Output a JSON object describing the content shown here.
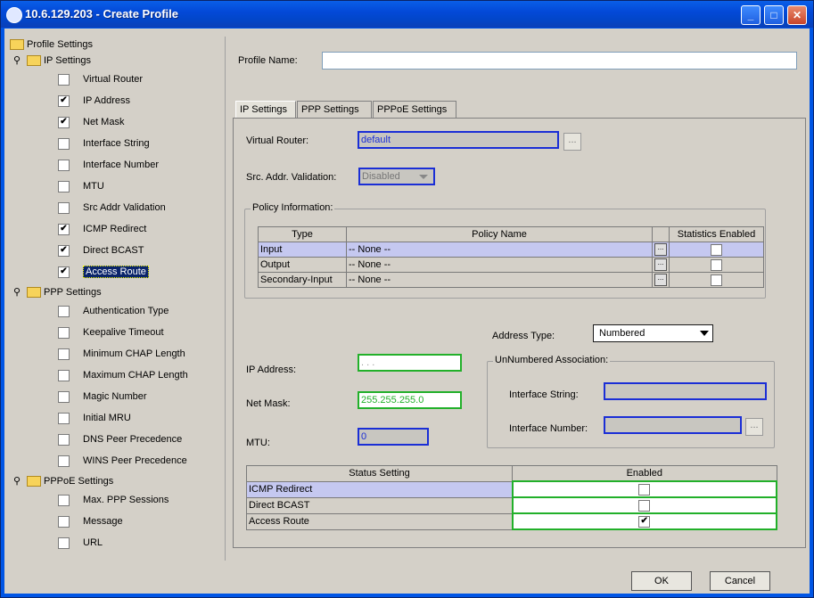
{
  "window": {
    "title": "10.6.129.203 - Create Profile"
  },
  "tree": {
    "root": "Profile Settings",
    "groups": [
      {
        "label": "IP Settings",
        "items": [
          {
            "label": "Virtual Router",
            "checked": false
          },
          {
            "label": "IP Address",
            "checked": true
          },
          {
            "label": "Net Mask",
            "checked": true
          },
          {
            "label": "Interface String",
            "checked": false
          },
          {
            "label": "Interface Number",
            "checked": false
          },
          {
            "label": "MTU",
            "checked": false
          },
          {
            "label": "Src Addr Validation",
            "checked": false
          },
          {
            "label": "ICMP Redirect",
            "checked": true
          },
          {
            "label": "Direct BCAST",
            "checked": true
          },
          {
            "label": "Access Route",
            "checked": true
          }
        ]
      },
      {
        "label": "PPP Settings",
        "items": [
          {
            "label": "Authentication Type",
            "checked": false
          },
          {
            "label": "Keepalive Timeout",
            "checked": false
          },
          {
            "label": "Minimum CHAP Length",
            "checked": false
          },
          {
            "label": "Maximum CHAP Length",
            "checked": false
          },
          {
            "label": "Magic Number",
            "checked": false
          },
          {
            "label": "Initial MRU",
            "checked": false
          },
          {
            "label": "DNS Peer Precedence",
            "checked": false
          },
          {
            "label": "WINS Peer Precedence",
            "checked": false
          }
        ]
      },
      {
        "label": "PPPoE Settings",
        "items": [
          {
            "label": "Max. PPP Sessions",
            "checked": false
          },
          {
            "label": "Message",
            "checked": false
          },
          {
            "label": "URL",
            "checked": false
          }
        ]
      }
    ]
  },
  "form": {
    "profile_name_label": "Profile Name:",
    "profile_name_value": "",
    "tabs": [
      "IP Settings",
      "PPP Settings",
      "PPPoE Settings"
    ],
    "virtual_router_label": "Virtual Router:",
    "virtual_router_value": "default",
    "src_addr_label": "Src. Addr. Validation:",
    "src_addr_value": "Disabled",
    "policy_group_title": "Policy Information:",
    "policy_headers": [
      "Type",
      "Policy Name",
      "Statistics Enabled"
    ],
    "policy_rows": [
      {
        "type": "Input",
        "name": "-- None --"
      },
      {
        "type": "Output",
        "name": "-- None --"
      },
      {
        "type": "Secondary-Input",
        "name": "-- None --"
      }
    ],
    "address_type_label": "Address Type:",
    "address_type_value": "Numbered",
    "ip_address_label": "IP Address:",
    "ip_address_value": ".   .   .",
    "net_mask_label": "Net Mask:",
    "net_mask_value": "255.255.255.0",
    "mtu_label": "MTU:",
    "mtu_value": "0",
    "unnumbered_title": "UnNumbered Association:",
    "interface_string_label": "Interface String:",
    "interface_number_label": "Interface Number:",
    "status_headers": [
      "Status Setting",
      "Enabled"
    ],
    "status_rows": [
      {
        "label": "ICMP Redirect",
        "enabled": false
      },
      {
        "label": "Direct BCAST",
        "enabled": false
      },
      {
        "label": "Access Route",
        "enabled": true
      }
    ]
  },
  "buttons": {
    "ok": "OK",
    "cancel": "Cancel"
  },
  "ellipsis": "...",
  "check_mark": "✔"
}
